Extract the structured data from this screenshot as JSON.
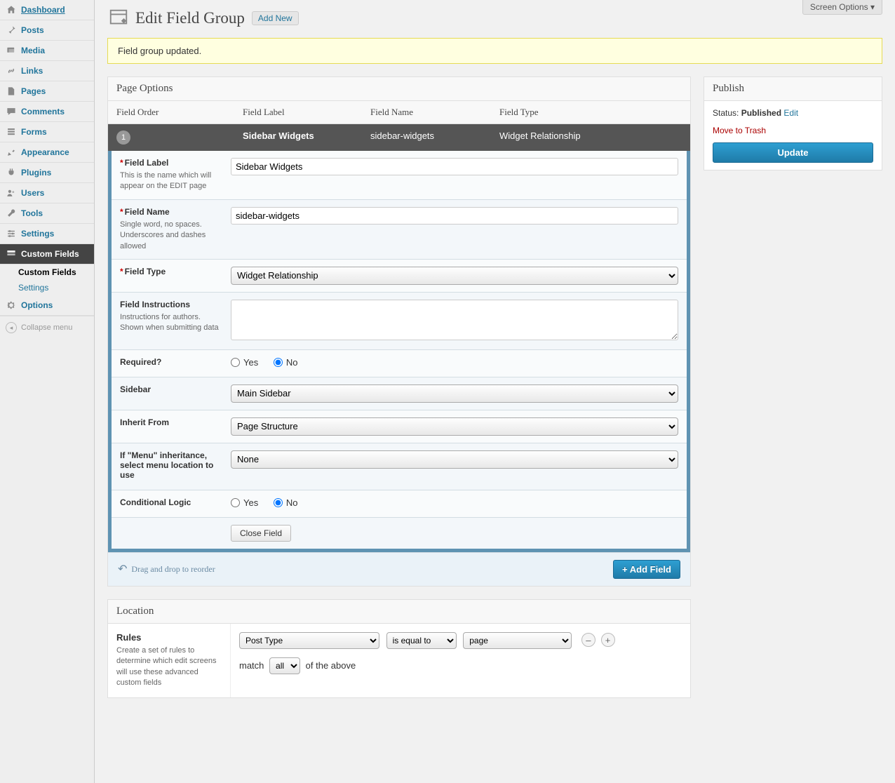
{
  "screenOptions": "Screen Options ▾",
  "sidebar": {
    "items": [
      {
        "label": "Dashboard"
      },
      {
        "label": "Posts"
      },
      {
        "label": "Media"
      },
      {
        "label": "Links"
      },
      {
        "label": "Pages"
      },
      {
        "label": "Comments"
      },
      {
        "label": "Forms"
      },
      {
        "label": "Appearance"
      },
      {
        "label": "Plugins"
      },
      {
        "label": "Users"
      },
      {
        "label": "Tools"
      },
      {
        "label": "Settings"
      },
      {
        "label": "Custom Fields"
      },
      {
        "label": "Options"
      }
    ],
    "submenu": [
      {
        "label": "Custom Fields"
      },
      {
        "label": "Settings"
      }
    ],
    "collapse": "Collapse menu"
  },
  "header": {
    "title": "Edit Field Group",
    "addNew": "Add New"
  },
  "notice": "Field group updated.",
  "groupTitle": "Page Options",
  "cols": {
    "order": "Field Order",
    "label": "Field Label",
    "name": "Field Name",
    "type": "Field Type"
  },
  "field": {
    "num": "1",
    "label": "Sidebar Widgets",
    "name": "sidebar-widgets",
    "type": "Widget Relationship"
  },
  "edit": {
    "fieldLabel": {
      "title": "Field Label",
      "desc": "This is the name which will appear on the EDIT page",
      "value": "Sidebar Widgets"
    },
    "fieldName": {
      "title": "Field Name",
      "desc": "Single word, no spaces. Underscores and dashes allowed",
      "value": "sidebar-widgets"
    },
    "fieldType": {
      "title": "Field Type",
      "value": "Widget Relationship"
    },
    "instructions": {
      "title": "Field Instructions",
      "desc": "Instructions for authors. Shown when submitting data",
      "value": ""
    },
    "required": {
      "title": "Required?",
      "yes": "Yes",
      "no": "No",
      "value": "No"
    },
    "sidebar": {
      "title": "Sidebar",
      "value": "Main Sidebar"
    },
    "inherit": {
      "title": "Inherit From",
      "value": "Page Structure"
    },
    "menu": {
      "title": "If \"Menu\" inheritance, select menu location to use",
      "value": "None"
    },
    "cond": {
      "title": "Conditional Logic",
      "yes": "Yes",
      "no": "No",
      "value": "No"
    },
    "close": "Close Field"
  },
  "drag": {
    "hint": "Drag and drop to reorder",
    "add": "+ Add Field"
  },
  "location": {
    "title": "Location",
    "rulesTitle": "Rules",
    "rulesDesc": "Create a set of rules to determine which edit screens will use these advanced custom fields",
    "rule": {
      "param": "Post Type",
      "operator": "is equal to",
      "value": "page"
    },
    "matchPre": "match",
    "matchSel": "all",
    "matchPost": "of the above",
    "minus": "–",
    "plus": "+"
  },
  "publish": {
    "title": "Publish",
    "statusLabel": "Status:",
    "statusValue": "Published",
    "edit": "Edit",
    "trash": "Move to Trash",
    "update": "Update"
  }
}
